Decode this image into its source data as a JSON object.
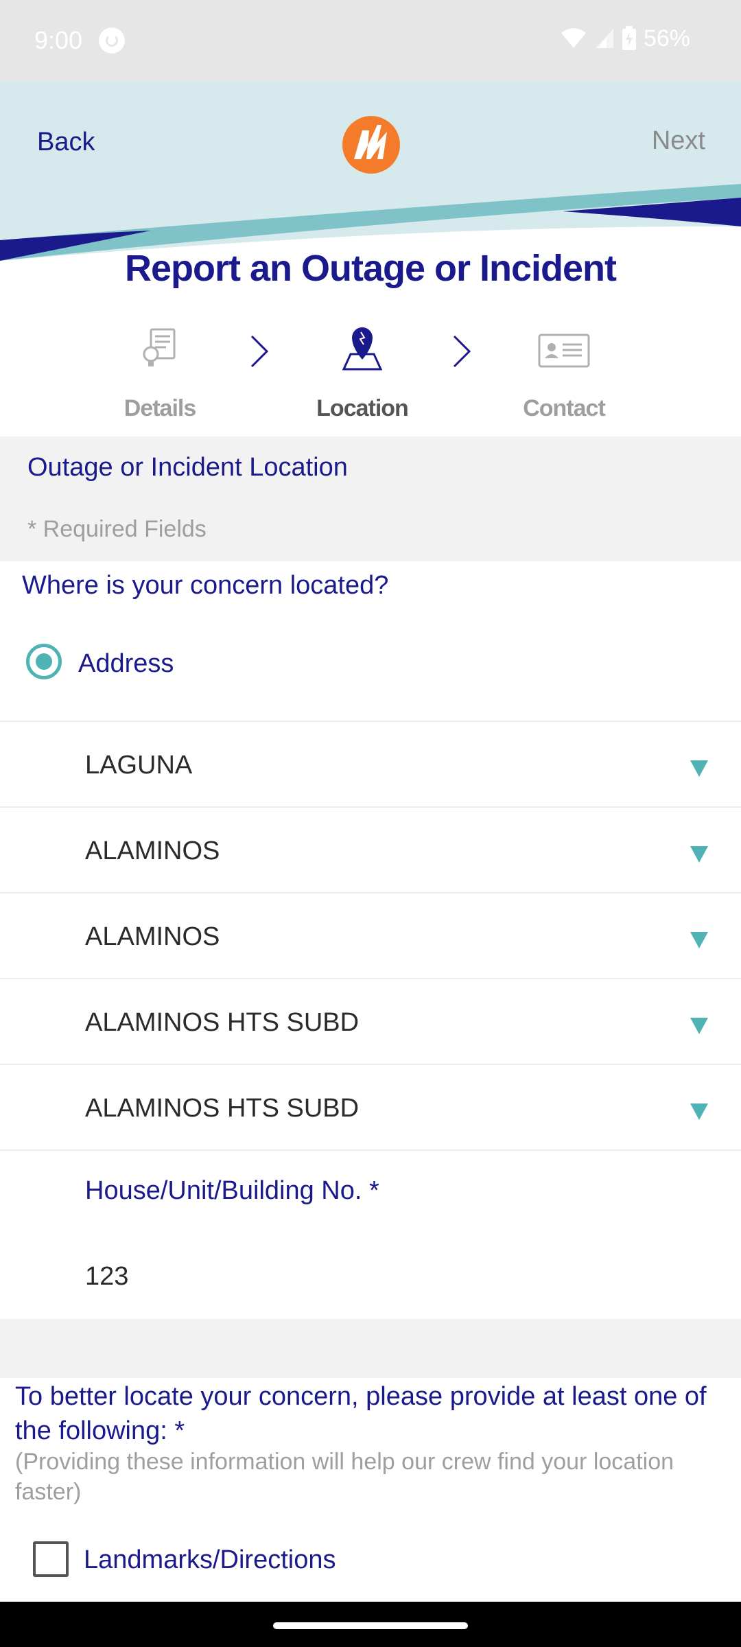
{
  "status_bar": {
    "time": "9:00",
    "battery": "56%"
  },
  "header": {
    "back_label": "Back",
    "next_label": "Next"
  },
  "page_title": "Report an Outage or Incident",
  "steps": [
    {
      "label": "Details",
      "state": "inactive"
    },
    {
      "label": "Location",
      "state": "active"
    },
    {
      "label": "Contact",
      "state": "inactive"
    }
  ],
  "section": {
    "title": "Outage or Incident Location",
    "required_note": "* Required Fields"
  },
  "question": "Where is your concern located?",
  "location_type": {
    "label": "Address",
    "selected": true
  },
  "selects": [
    {
      "value": "LAGUNA"
    },
    {
      "value": "ALAMINOS"
    },
    {
      "value": "ALAMINOS"
    },
    {
      "value": "ALAMINOS HTS SUBD"
    },
    {
      "value": "ALAMINOS HTS SUBD"
    }
  ],
  "house_field": {
    "label": "House/Unit/Building No. *",
    "value": "123"
  },
  "locate": {
    "text": "To better locate your concern, please provide at least one of the following: *",
    "hint": "(Providing these information will help our crew find your location faster)"
  },
  "landmarks": {
    "label": "Landmarks/Directions",
    "checked": false
  },
  "colors": {
    "brand_navy": "#1a1a8c",
    "accent_teal": "#4fb3b5",
    "brand_orange": "#f47b2a",
    "header_bg": "#d6e9ec"
  }
}
